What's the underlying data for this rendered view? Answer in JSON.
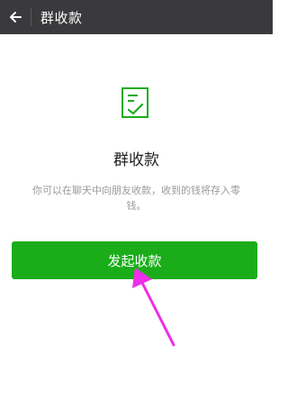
{
  "header": {
    "back_icon": "back-arrow-icon",
    "title": "群收款"
  },
  "main": {
    "icon": "receipt-check-icon",
    "title": "群收款",
    "description": "你可以在聊天中向朋友收款，收到的钱将存入零钱。",
    "primary_button_label": "发起收款"
  },
  "colors": {
    "topbar": "#3a3a3d",
    "accent": "#1aad19",
    "annotation_arrow": "#ee2ee8"
  }
}
